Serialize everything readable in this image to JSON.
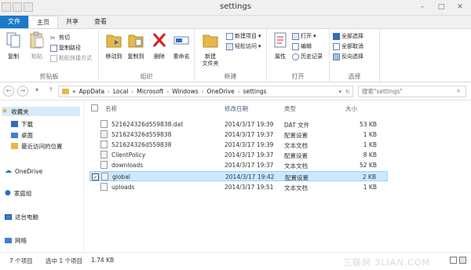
{
  "window": {
    "title": "settings"
  },
  "tabs": [
    "文件",
    "主页",
    "共享",
    "查看"
  ],
  "ribbon": {
    "clipboard": {
      "label": "剪贴板",
      "copy": "复制",
      "paste": "粘贴",
      "cut": "剪切",
      "copy_path": "复制路径",
      "paste_shortcut": "粘贴快捷方式"
    },
    "organize": {
      "label": "组织",
      "move_to": "移动到",
      "copy_to": "复制到",
      "delete": "删除",
      "rename": "重命名"
    },
    "new": {
      "label": "新建",
      "new_folder": "新建\n文件夹",
      "new_item": "新建项目",
      "easy_access": "轻松访问"
    },
    "open": {
      "label": "打开",
      "properties": "属性",
      "open": "打开",
      "edit": "编辑",
      "history": "历史记录"
    },
    "select": {
      "label": "选择",
      "select_all": "全部选择",
      "select_none": "全部取消",
      "invert": "反向选择"
    }
  },
  "address": {
    "crumbs": [
      "«",
      "AppData",
      "Local",
      "Microsoft",
      "Windows",
      "OneDrive",
      "settings"
    ],
    "search_placeholder": "搜索\"settings\""
  },
  "sidebar": {
    "items": [
      "收藏夹",
      "下载",
      "桌面",
      "最近访问的位置",
      "OneDrive",
      "家庭组",
      "这台电脑",
      "网络"
    ]
  },
  "columns": [
    "名称",
    "修改日期",
    "类型",
    "大小"
  ],
  "files": [
    {
      "name": "521624326d559838.dat",
      "date": "2014/3/17 19:39",
      "type": "DAT 文件",
      "size": "53 KB"
    },
    {
      "name": "521624326d559838",
      "date": "2014/3/17 19:37",
      "type": "配置设置",
      "size": "1 KB"
    },
    {
      "name": "521624326d559838",
      "date": "2014/3/17 19:39",
      "type": "文本文档",
      "size": "1 KB"
    },
    {
      "name": "ClientPolicy",
      "date": "2014/3/17 19:37",
      "type": "配置设置",
      "size": "8 KB"
    },
    {
      "name": "downloads",
      "date": "2014/3/17 19:37",
      "type": "文本文档",
      "size": "52 KB"
    },
    {
      "name": "global",
      "date": "2014/3/17 19:42",
      "type": "配置设置",
      "size": "2 KB"
    },
    {
      "name": "uploads",
      "date": "2014/3/17 19:51",
      "type": "文本文档",
      "size": "1 KB"
    }
  ],
  "status": {
    "count": "7 个项目",
    "selected": "选中 1 个项目",
    "size": "1.74 KB"
  },
  "watermark": "三联网 3LIAN.COM",
  "colors": {
    "accent": "#1979ca",
    "selection": "#cce8ff",
    "folder": "#e6b84a"
  }
}
